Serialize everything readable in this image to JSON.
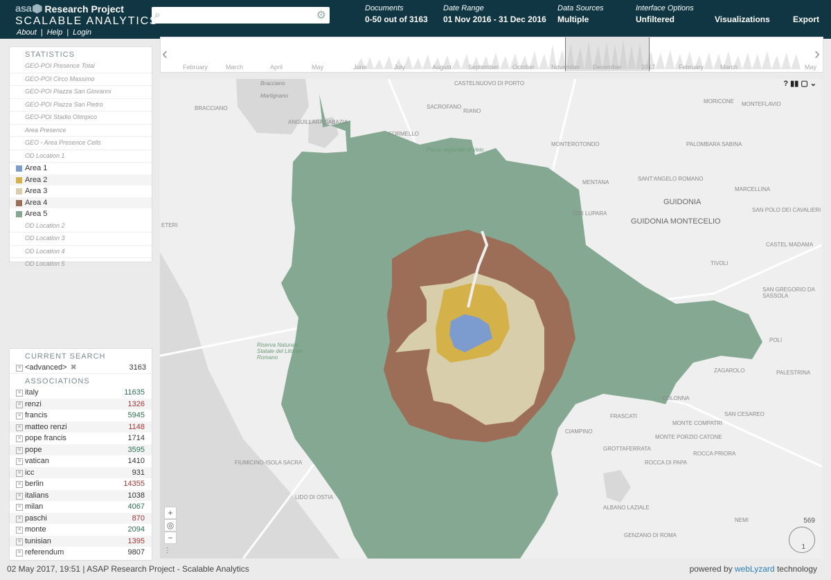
{
  "brand": {
    "logo": "asa",
    "project": "Research Project",
    "subtitle": "SCALABLE ANALYTICS",
    "links": [
      "About",
      "Help",
      "Login"
    ]
  },
  "search": {
    "value": "",
    "placeholder": ""
  },
  "header": {
    "documents": {
      "label": "Documents",
      "value": "0-50 out of 3163"
    },
    "daterange": {
      "label": "Date Range",
      "value": "01 Nov 2016 - 31 Dec 2016"
    },
    "sources": {
      "label": "Data Sources",
      "value": "Multiple"
    },
    "interface": {
      "label": "Interface Options",
      "value": "Unfiltered"
    },
    "visualizations": "Visualizations",
    "export": "Export"
  },
  "timeline": {
    "months": [
      "February",
      "March",
      "April",
      "May",
      "June",
      "July",
      "August",
      "September",
      "October",
      "November",
      "December",
      "2017",
      "February",
      "March",
      "May"
    ]
  },
  "statistics": {
    "title": "STATISTICS",
    "items": [
      "GEO-POI Presence Total",
      "GEO-POI Circo Massimo",
      "GEO-POI Piazza San Giovanni",
      "GEO-POI Piazza San Pietro",
      "GEO-POI Stadio Olimpico",
      "Area Presence",
      "GEO - Area Presence Cells",
      "OD Location 1"
    ],
    "areas": [
      {
        "label": "Area 1",
        "color": "#7c9ccf"
      },
      {
        "label": "Area 2",
        "color": "#d4b249"
      },
      {
        "label": "Area 3",
        "color": "#d9ceac"
      },
      {
        "label": "Area 4",
        "color": "#9c6e58"
      },
      {
        "label": "Area 5",
        "color": "#84a891"
      }
    ],
    "more": [
      "OD Location 2",
      "OD Location 3",
      "OD Location 4",
      "OD Location 5"
    ]
  },
  "current_search": {
    "title": "CURRENT SEARCH",
    "query": "<advanced>",
    "count": "3163"
  },
  "associations": {
    "title": "ASSOCIATIONS",
    "items": [
      {
        "term": "italy",
        "count": "11635",
        "color": "#2a6e4f"
      },
      {
        "term": "renzi",
        "count": "1326",
        "color": "#a83232"
      },
      {
        "term": "francis",
        "count": "5945",
        "color": "#2a6e4f"
      },
      {
        "term": "matteo renzi",
        "count": "1148",
        "color": "#a83232"
      },
      {
        "term": "pope francis",
        "count": "1714",
        "color": "#333333"
      },
      {
        "term": "pope",
        "count": "3595",
        "color": "#2a6e4f"
      },
      {
        "term": "vatican",
        "count": "1410",
        "color": "#333333"
      },
      {
        "term": "icc",
        "count": "931",
        "color": "#333333"
      },
      {
        "term": "berlin",
        "count": "14355",
        "color": "#a83232"
      },
      {
        "term": "italians",
        "count": "1038",
        "color": "#333333"
      },
      {
        "term": "milan",
        "count": "4067",
        "color": "#2a6e4f"
      },
      {
        "term": "paschi",
        "count": "870",
        "color": "#a83232"
      },
      {
        "term": "monte",
        "count": "2094",
        "color": "#2a6e4f"
      },
      {
        "term": "tunisian",
        "count": "1395",
        "color": "#a83232"
      },
      {
        "term": "referendum",
        "count": "9807",
        "color": "#333333"
      }
    ]
  },
  "map": {
    "controls": "? ▮▮ ▢ ⌄",
    "labels": [
      "Bracciano",
      "Martignano",
      "BRACCIANO",
      "ANGUILLARA SABAZIA",
      "CASTELNUOVO DI PORTO",
      "SACROFANO",
      "RIANO",
      "FORMELLO",
      "Parco regionale di Veio",
      "MONTEROTONDO",
      "MORICONE",
      "MONTEFLAVIO",
      "PALOMBARA SABINA",
      "MENTANA",
      "SANT'ANGELO ROMANO",
      "MARCELLINA",
      "GUIDONIA",
      "GUIDONIA MONTECELIO",
      "TOR LUPARA",
      "SAN POLO DEI CAVALIERI",
      "CASTEL MADAMA",
      "TIVOLI",
      "SAN GREGORIO DA SASSOLA",
      "POLI",
      "ZAGAROLO",
      "PALESTRINA",
      "Riserva Naturale Statale del Litorale Romano",
      "FIUMICINO-ISOLA SACRA",
      "LIDO DI OSTIA",
      "CIAMPINO",
      "GROTTAFERRATA",
      "ROCCA DI PAPA",
      "ROCCA PRIORA",
      "ALBANO LAZIALE",
      "GENZANO DI ROMA",
      "FRASCATI",
      "COLONNA",
      "SAN CESAREO",
      "MONTE COMPATRI",
      "MONTE PORZIO CATONE",
      "NEMI",
      "ETERI"
    ],
    "counter_top": "569",
    "counter_bottom": "1"
  },
  "footer": {
    "left": "02 May 2017, 19:51 | ASAP Research Project - Scalable Analytics",
    "powered": "powered by",
    "brand": "webLyzard",
    "tech": "technology"
  }
}
